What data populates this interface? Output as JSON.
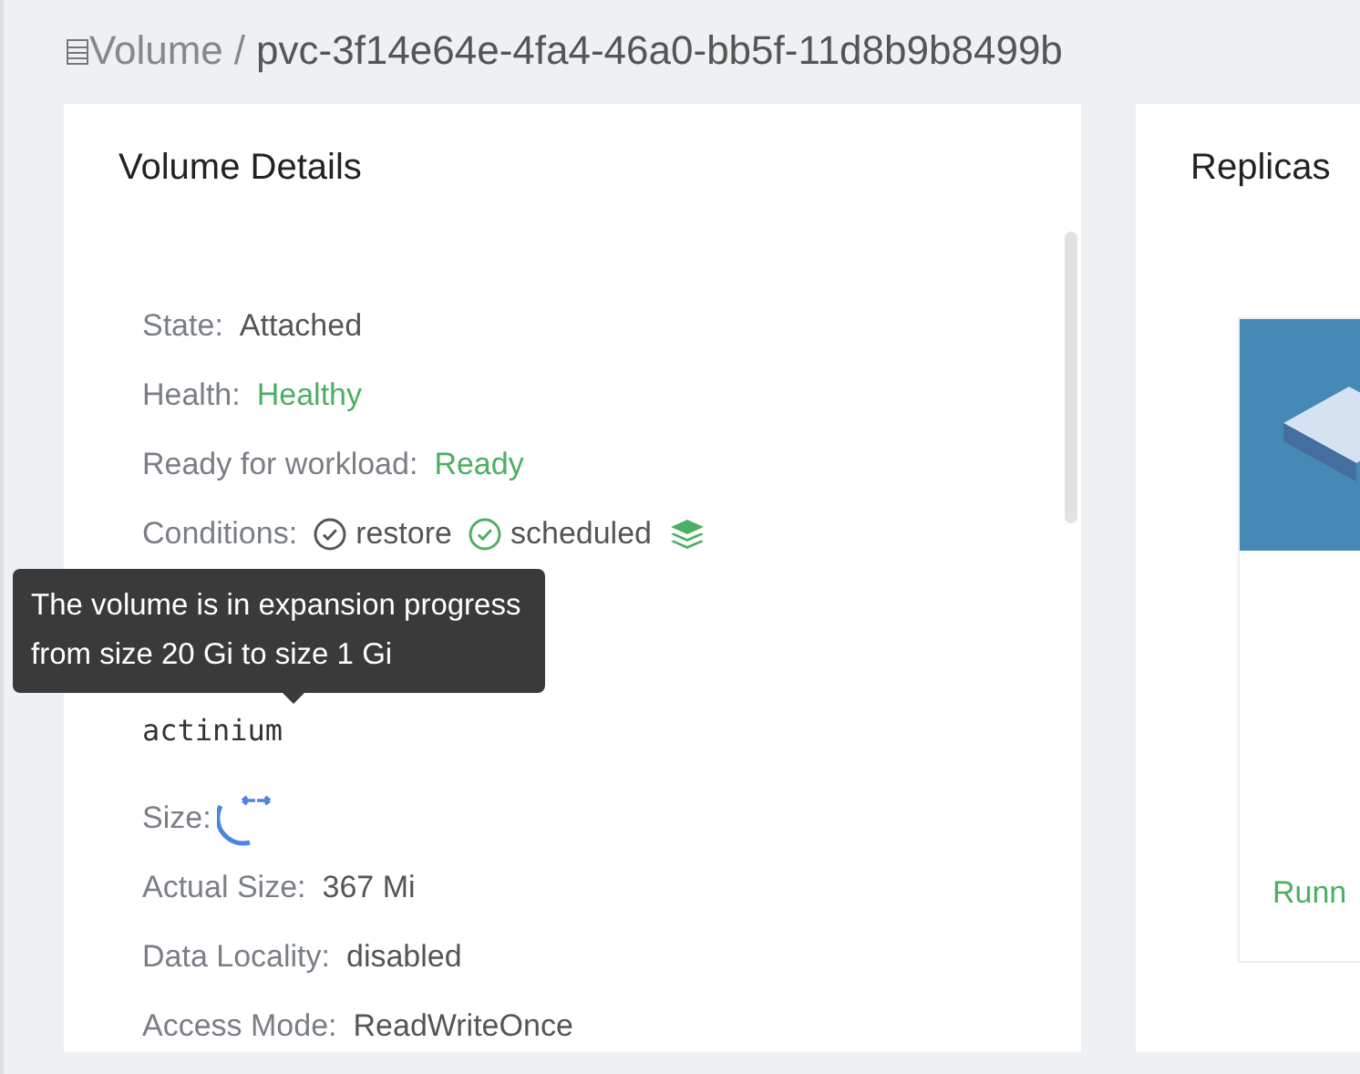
{
  "breadcrumb": {
    "section": "Volume",
    "separator": "/",
    "name": "pvc-3f14e64e-4fa4-46a0-bb5f-11d8b9b8499b"
  },
  "details": {
    "title": "Volume Details",
    "rows": [
      {
        "kind": "text",
        "label": "State:",
        "value": "Attached",
        "highlight": false
      },
      {
        "kind": "text",
        "label": "Health:",
        "value": "Healthy",
        "highlight": true
      },
      {
        "kind": "text",
        "label": "Ready for workload:",
        "value": "Ready",
        "highlight": true
      },
      {
        "kind": "conditions",
        "label": "Conditions:",
        "conditions": [
          {
            "name": "restore",
            "color": "#555555"
          },
          {
            "name": "scheduled",
            "color": "#4caf63"
          }
        ]
      },
      {
        "kind": "mono",
        "value": "actinium"
      },
      {
        "kind": "spinner",
        "label": "Size:"
      },
      {
        "kind": "text",
        "label": "Actual Size:",
        "value": "367 Mi",
        "highlight": false
      },
      {
        "kind": "text",
        "label": "Data Locality:",
        "value": "disabled",
        "highlight": false
      },
      {
        "kind": "text",
        "label": "Access Mode:",
        "value": "ReadWriteOnce",
        "highlight": false
      }
    ],
    "tooltip": "The volume is in expansion progress from size 20 Gi to size 1 Gi"
  },
  "replicas": {
    "title": "Replicas",
    "cards": [
      {
        "kind": "picture",
        "status": "Runn"
      }
    ]
  }
}
